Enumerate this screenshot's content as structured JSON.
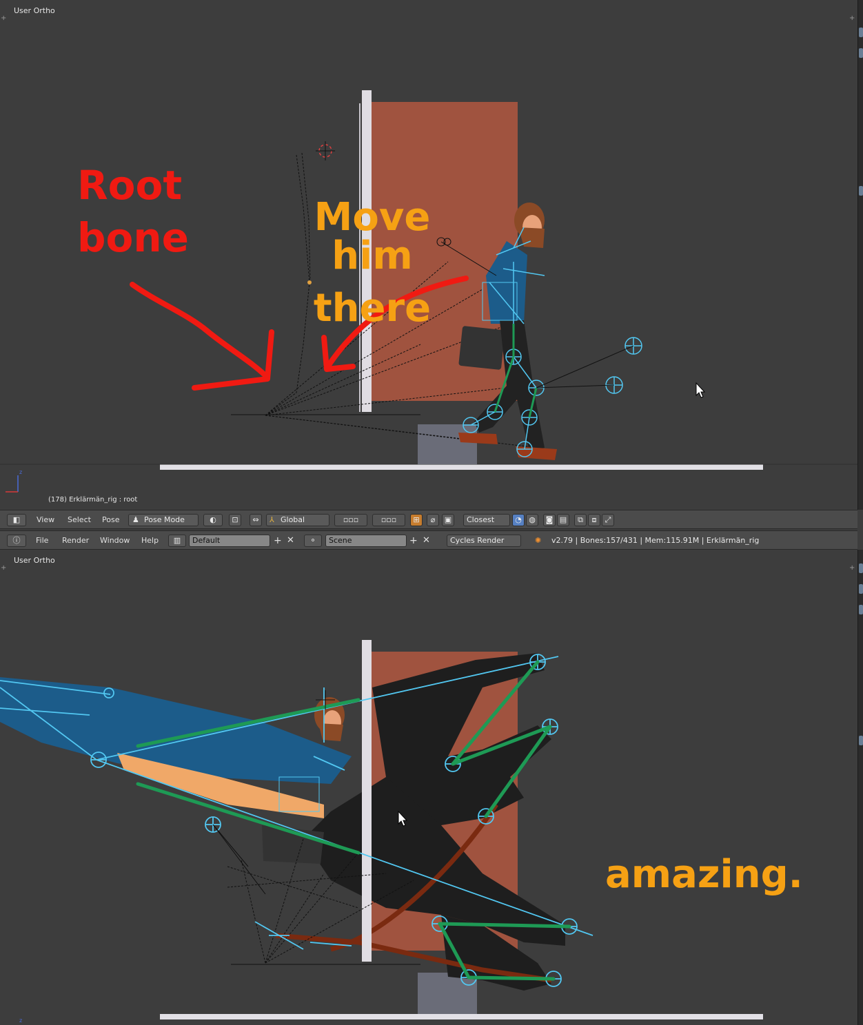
{
  "top_viewport": {
    "label": "User Ortho",
    "status": "(178) Erklärmän_rig : root",
    "annotations": {
      "root_bone_line1": "Root",
      "root_bone_line2": "bone",
      "move_line1": "Move him",
      "move_line2": "there"
    }
  },
  "bottom_viewport": {
    "label": "User Ortho",
    "annotation": "amazing."
  },
  "view3d_header": {
    "view": "View",
    "select": "Select",
    "pose": "Pose",
    "mode": "Pose Mode",
    "orientation": "Global",
    "snap": "Closest"
  },
  "info_header": {
    "file": "File",
    "render": "Render",
    "window": "Window",
    "help": "Help",
    "screen_layout": "Default",
    "scene": "Scene",
    "engine": "Cycles Render",
    "stats": "v2.79 | Bones:157/431 | Mem:115.91M | Erklärmän_rig"
  },
  "colors": {
    "viewport_bg": "#3d3d3d",
    "door": "#a0533f",
    "wall": "#e0dde3",
    "bone": "#52c8f2",
    "annotation_red": "#f01a12",
    "annotation_orange": "#f6a114"
  }
}
